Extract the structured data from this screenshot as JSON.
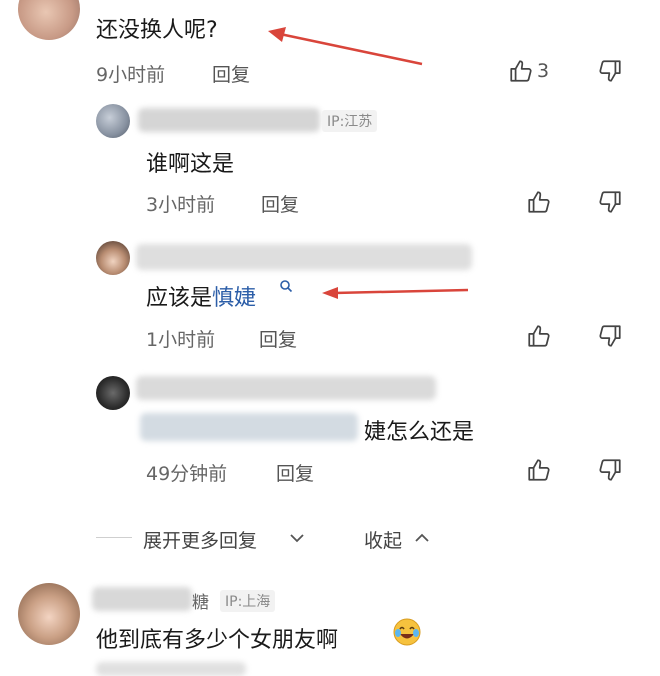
{
  "comments": {
    "top": {
      "text": "还没换人呢?",
      "time": "9小时前",
      "reply": "回复",
      "likes": "3"
    },
    "sub1": {
      "ip": "IP:江苏",
      "text": "谁啊这是",
      "time": "3小时前",
      "reply": "回复"
    },
    "sub2": {
      "text_prefix": "应该是",
      "link": "慎婕",
      "time": "1小时前",
      "reply": "回复"
    },
    "sub3": {
      "text_suffix": "婕怎么还是",
      "time": "49分钟前",
      "reply": "回复"
    },
    "expand": {
      "more": "展开更多回复",
      "collapse": "收起"
    },
    "bottom": {
      "name_tail": "糖",
      "ip": "IP:上海",
      "text": "他到底有多少个女朋友啊"
    }
  },
  "colors": {
    "arrow": "#d9453b",
    "link": "#2c5ea8"
  },
  "icons": [
    "thumb-up-icon",
    "thumb-down-icon",
    "search-icon",
    "chevron-down-icon",
    "chevron-up-icon",
    "crying-laugh-emoji-icon"
  ]
}
